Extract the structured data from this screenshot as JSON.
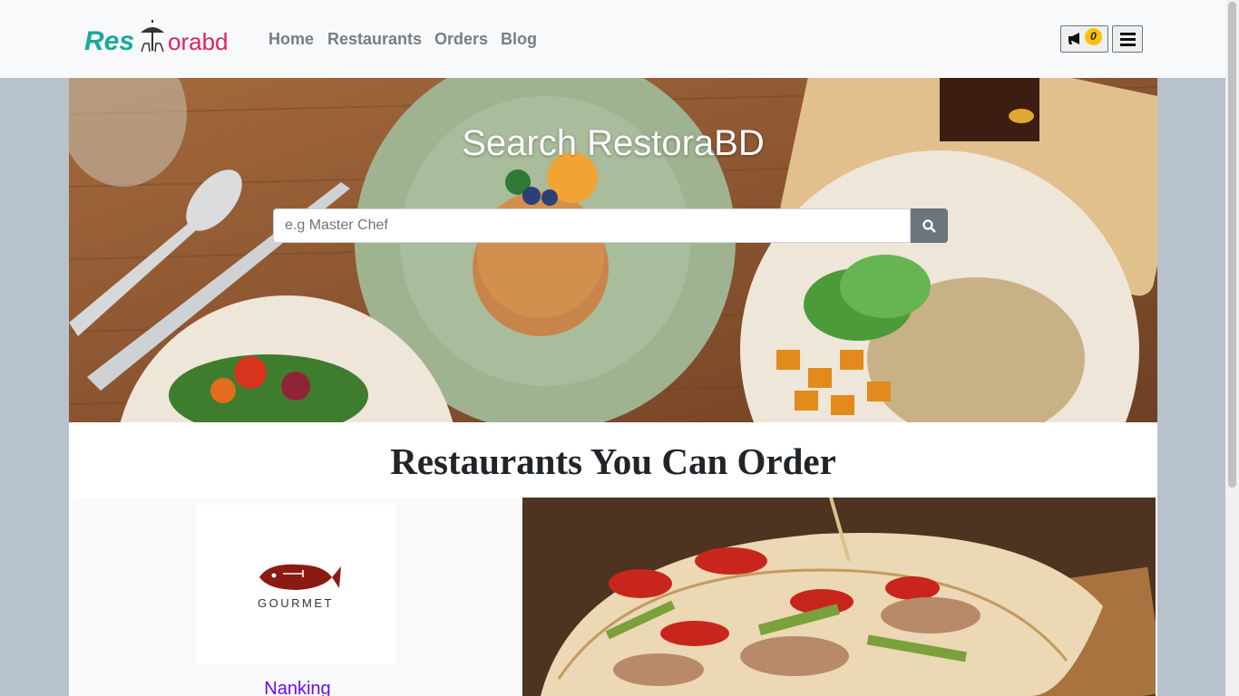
{
  "brand": {
    "logo_left": "Res",
    "logo_mid": "t",
    "logo_right": "orabd",
    "colors": {
      "teal": "#1aa99d",
      "pink": "#e0205e"
    }
  },
  "nav": {
    "links": [
      "Home",
      "Restaurants",
      "Orders",
      "Blog"
    ],
    "notification_count": "0",
    "notification_icon": "bullhorn-icon",
    "menu_icon": "hamburger-menu-icon"
  },
  "hero": {
    "title": "Search RestoraBD",
    "search_placeholder": "e.g Master Chef",
    "search_icon": "search-icon"
  },
  "section": {
    "title": "Restaurants You Can Order"
  },
  "restaurant": {
    "logo_text": "GOURMET",
    "name": "Nanking"
  }
}
